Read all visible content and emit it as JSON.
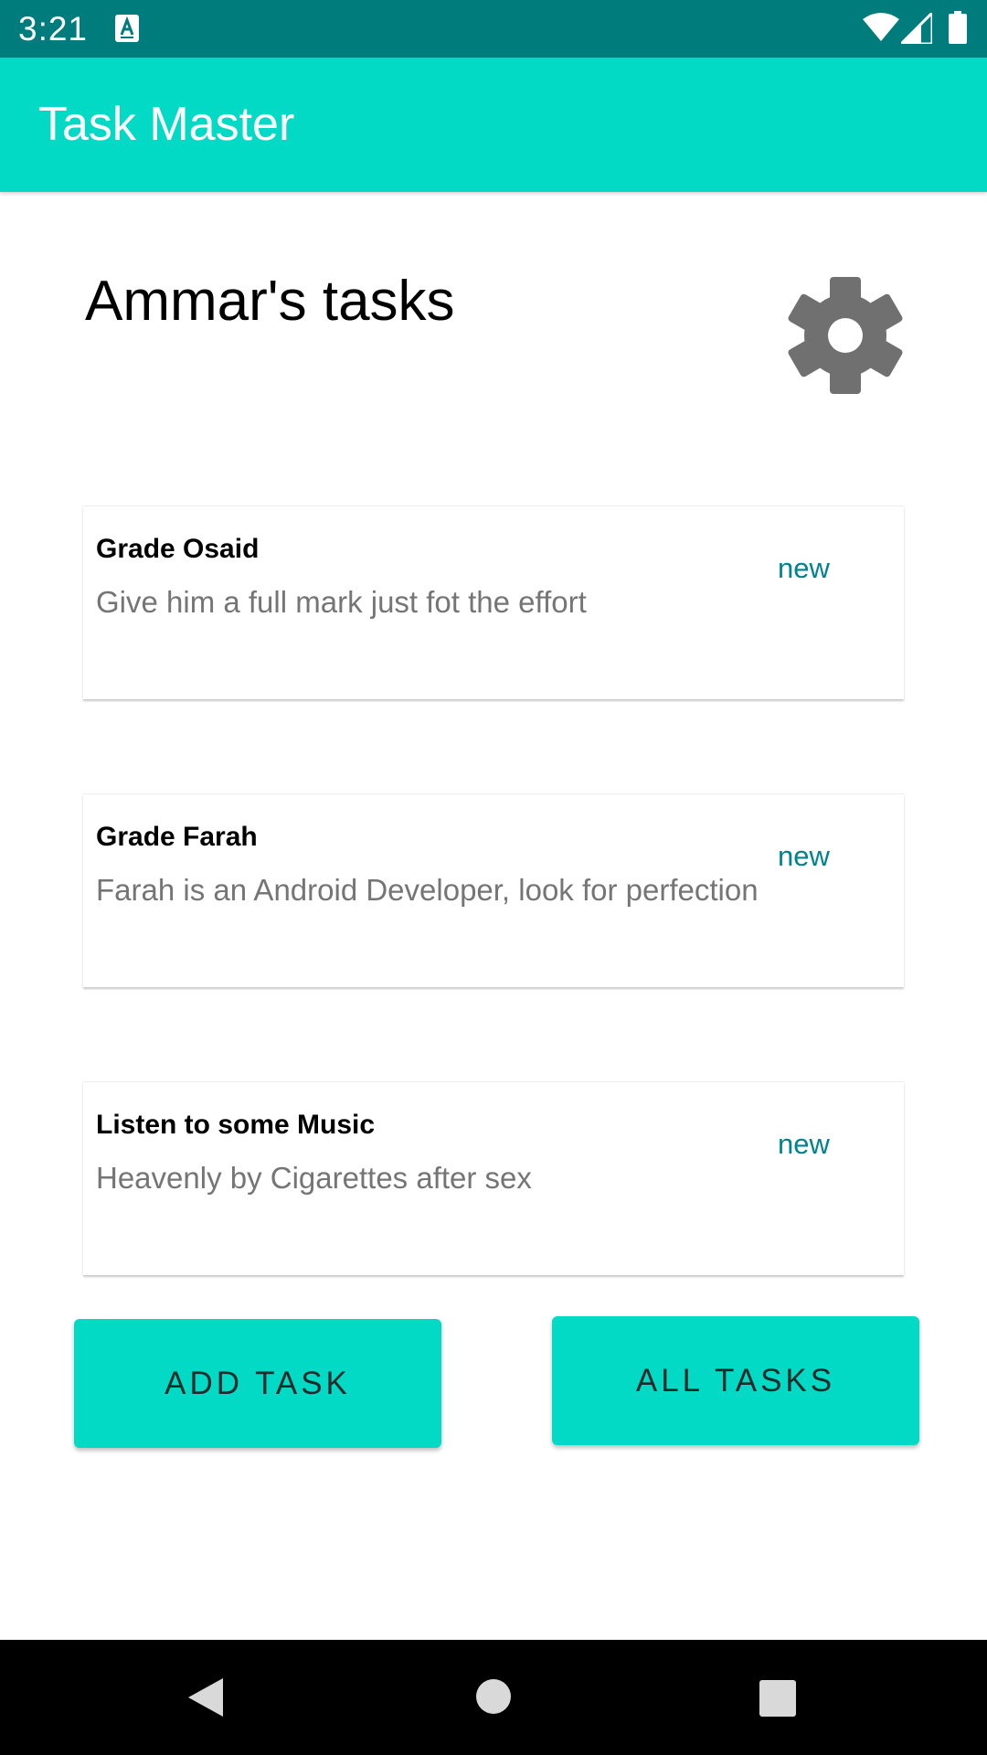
{
  "status_bar": {
    "time": "3:21",
    "icons": [
      "keyboard-a-icon",
      "wifi-icon",
      "signal-icon",
      "battery-icon"
    ]
  },
  "app_bar": {
    "title": "Task Master"
  },
  "header": {
    "title": "Ammar's tasks",
    "settings_icon": "gear-icon"
  },
  "tasks": [
    {
      "title": "Grade Osaid",
      "body": "Give him a full mark just fot the effort",
      "state": "new"
    },
    {
      "title": "Grade Farah",
      "body": "Farah is an Android Developer, look for perfection",
      "state": "new"
    },
    {
      "title": "Listen to some Music",
      "body": "Heavenly by Cigarettes after sex",
      "state": "new"
    }
  ],
  "buttons": {
    "add_task": "ADD TASK",
    "all_tasks": "ALL TASKS"
  },
  "nav_bar": {
    "icons": [
      "back-icon",
      "home-icon",
      "recents-icon"
    ]
  },
  "colors": {
    "status_bar": "#007c7c",
    "primary": "#03dac5",
    "state_text": "#00838f",
    "icon_gray": "#707070"
  }
}
